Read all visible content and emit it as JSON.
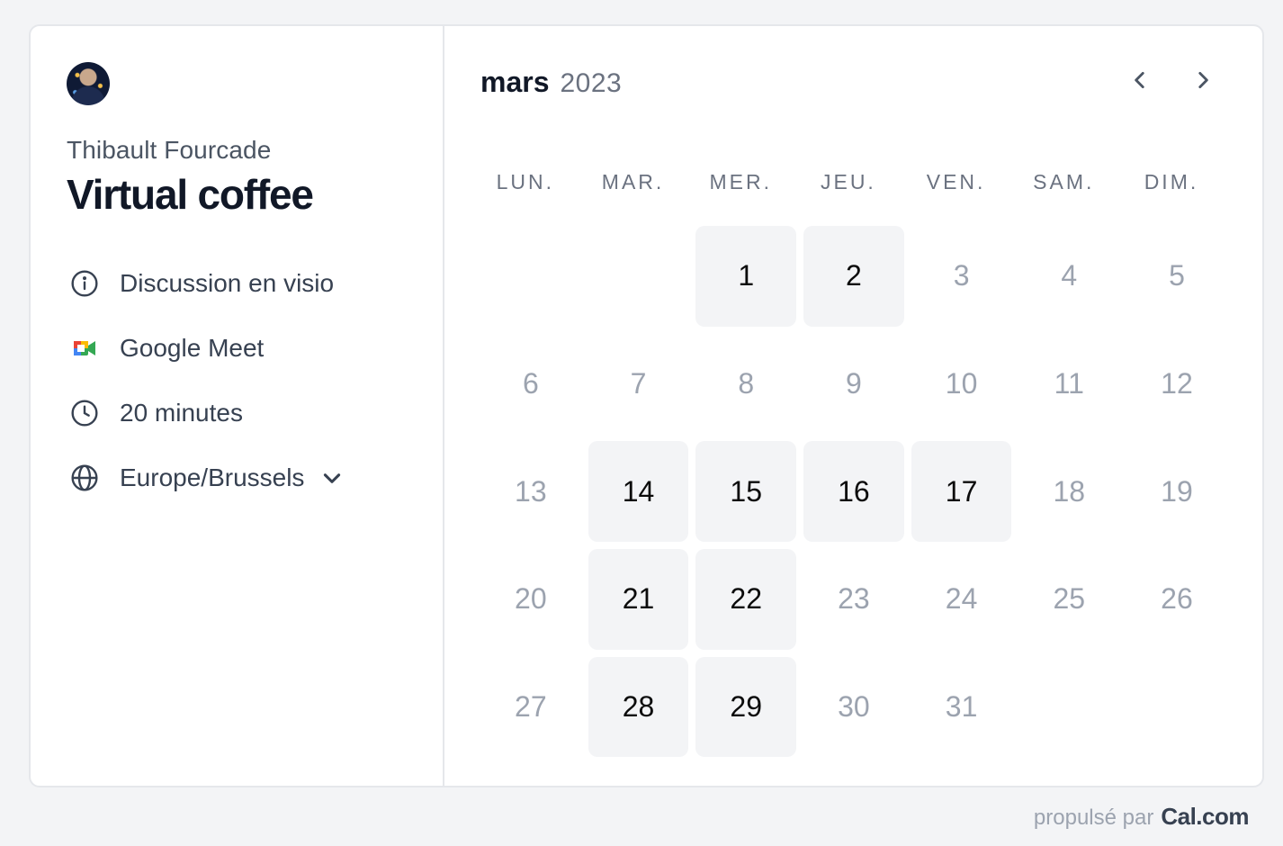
{
  "event": {
    "owner": "Thibault Fourcade",
    "title": "Virtual coffee",
    "description": "Discussion en visio",
    "location": "Google Meet",
    "duration": "20 minutes",
    "timezone": "Europe/Brussels"
  },
  "calendar": {
    "month": "mars",
    "year": "2023",
    "weekdays": [
      "LUN.",
      "MAR.",
      "MER.",
      "JEU.",
      "VEN.",
      "SAM.",
      "DIM."
    ],
    "leading_blanks": 2,
    "days": [
      {
        "n": "1",
        "available": true
      },
      {
        "n": "2",
        "available": true
      },
      {
        "n": "3",
        "available": false
      },
      {
        "n": "4",
        "available": false
      },
      {
        "n": "5",
        "available": false
      },
      {
        "n": "6",
        "available": false
      },
      {
        "n": "7",
        "available": false
      },
      {
        "n": "8",
        "available": false
      },
      {
        "n": "9",
        "available": false
      },
      {
        "n": "10",
        "available": false
      },
      {
        "n": "11",
        "available": false
      },
      {
        "n": "12",
        "available": false
      },
      {
        "n": "13",
        "available": false
      },
      {
        "n": "14",
        "available": true
      },
      {
        "n": "15",
        "available": true
      },
      {
        "n": "16",
        "available": true
      },
      {
        "n": "17",
        "available": true
      },
      {
        "n": "18",
        "available": false
      },
      {
        "n": "19",
        "available": false
      },
      {
        "n": "20",
        "available": false
      },
      {
        "n": "21",
        "available": true
      },
      {
        "n": "22",
        "available": true
      },
      {
        "n": "23",
        "available": false
      },
      {
        "n": "24",
        "available": false
      },
      {
        "n": "25",
        "available": false
      },
      {
        "n": "26",
        "available": false
      },
      {
        "n": "27",
        "available": false
      },
      {
        "n": "28",
        "available": true
      },
      {
        "n": "29",
        "available": true
      },
      {
        "n": "30",
        "available": false
      },
      {
        "n": "31",
        "available": false
      }
    ]
  },
  "footer": {
    "powered_by": "propulsé par",
    "brand": "Cal.com"
  },
  "icons": {
    "description": "info-icon",
    "location": "google-meet-icon",
    "duration": "clock-icon",
    "timezone": "globe-icon"
  },
  "colors": {
    "available_bg": "#f3f4f6",
    "unavailable_text": "#9ca3af",
    "background": "#f3f4f6"
  }
}
